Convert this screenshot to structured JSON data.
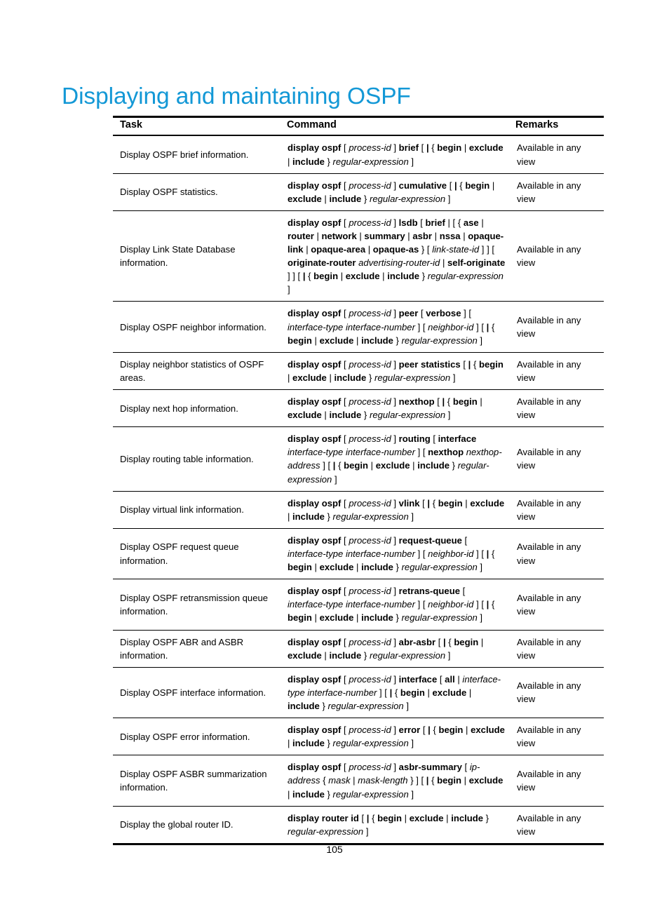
{
  "document": {
    "title": "Displaying and maintaining OSPF",
    "title_color": "#1398d6",
    "page_number": "105"
  },
  "table": {
    "headers": {
      "task": "Task",
      "command": "Command",
      "remarks": "Remarks"
    },
    "rows": [
      {
        "task": "Display OSPF brief information.",
        "command_html": "<b>display ospf</b> [ <i>process-id</i> ] <b>brief</b> [ <b>|</b> { <b>begin</b> | <b>exclude</b> | <b>include</b> } <i>regular-expression</i> ]",
        "command_text": "display ospf [ process-id ] brief [ | { begin | exclude | include } regular-expression ]",
        "remarks": "Available in any view"
      },
      {
        "task": "Display OSPF statistics.",
        "command_html": "<b>display ospf</b> [ <i>process-id</i> ] <b>cumulative</b> [ <b>|</b> { <b>begin</b> | <b>exclude</b> | <b>include</b> } <i>regular-expression</i> ]",
        "command_text": "display ospf [ process-id ] cumulative [ | { begin | exclude | include } regular-expression ]",
        "remarks": "Available in any view"
      },
      {
        "task": "Display Link State Database information.",
        "command_html": "<b>display ospf</b> [ <i>process-id</i> ] <b>lsdb</b> [ <b>brief</b> | [ { <b>ase</b> | <b>router</b> | <b>network</b> | <b>summary</b> | <b>asbr</b> | <b>nssa</b> | <b>opaque-link</b> | <b>opaque-area</b> | <b>opaque-as</b> } [ <i>link-state-id</i> ] ] [ <b>originate-router</b> <i>advertising-router-id</i> | <b>self-originate</b> ] ] [ <b>|</b> { <b>begin</b> | <b>exclude</b> | <b>include</b> } <i>regular-expression</i> ]",
        "command_text": "display ospf [ process-id ] lsdb [ brief | [ { ase | router | network | summary | asbr | nssa | opaque-link | opaque-area | opaque-as } [ link-state-id ] ] [ originate-router advertising-router-id | self-originate ] ] [ | { begin | exclude | include } regular-expression ]",
        "remarks": "Available in any view"
      },
      {
        "task": "Display OSPF neighbor information.",
        "command_html": "<b>display ospf</b> [ <i>process-id</i> ] <b>peer</b> [ <b>verbose</b> ] [ <i>interface-type interface-number</i> ] [ <i>neighbor-id</i> ] [ <b>|</b> { <b>begin</b> | <b>exclude</b> | <b>include</b> } <i>regular-expression</i> ]",
        "command_text": "display ospf [ process-id ] peer [ verbose ] [ interface-type interface-number ] [ neighbor-id ] [ | { begin | exclude | include } regular-expression ]",
        "remarks": "Available in any view"
      },
      {
        "task": "Display neighbor statistics of OSPF areas.",
        "command_html": "<b>display ospf</b> [ <i>process-id</i> ] <b>peer statistics</b> [ <b>|</b> { <b>begin</b> | <b>exclude</b> | <b>include</b> } <i>regular-expression</i> ]",
        "command_text": "display ospf [ process-id ] peer statistics [ | { begin | exclude | include } regular-expression ]",
        "remarks": "Available in any view"
      },
      {
        "task": "Display next hop information.",
        "command_html": "<b>display ospf</b> [ <i>process-id</i> ] <b>nexthop</b> [ <b>|</b> { <b>begin</b> | <b>exclude</b> | <b>include</b> } <i>regular-expression</i> ]",
        "command_text": "display ospf [ process-id ] nexthop [ | { begin | exclude | include } regular-expression ]",
        "remarks": "Available in any view"
      },
      {
        "task": "Display routing table information.",
        "command_html": "<b>display ospf</b> [ <i>process-id</i> ] <b>routing</b> [ <b>interface</b> <i>interface-type interface-number</i> ] [ <b>nexthop</b> <i>nexthop-address</i> ] [ <b>|</b> { <b>begin</b> | <b>exclude</b> | <b>include</b> } <i>regular-expression</i> ]",
        "command_text": "display ospf [ process-id ] routing [ interface interface-type interface-number ] [ nexthop nexthop-address ] [ | { begin | exclude | include } regular-expression ]",
        "remarks": "Available in any view"
      },
      {
        "task": "Display virtual link information.",
        "command_html": "<b>display ospf</b> [ <i>process-id</i> ] <b>vlink</b> [ <b>|</b> { <b>begin</b> | <b>exclude</b> | <b>include</b> } <i>regular-expression</i> ]",
        "command_text": "display ospf [ process-id ] vlink [ | { begin | exclude | include } regular-expression ]",
        "remarks": "Available in any view"
      },
      {
        "task": "Display OSPF request queue information.",
        "command_html": "<b>display ospf</b> [ <i>process-id</i> ] <b>request-queue</b> [ <i>interface-type interface-number</i> ] [ <i>neighbor-id</i> ] [ <b>|</b> { <b>begin</b> | <b>exclude</b> | <b>include</b> } <i>regular-expression</i> ]",
        "command_text": "display ospf [ process-id ] request-queue [ interface-type interface-number ] [ neighbor-id ] [ | { begin | exclude | include } regular-expression ]",
        "remarks": "Available in any view"
      },
      {
        "task": "Display OSPF retransmission queue information.",
        "command_html": "<b>display ospf</b> [ <i>process-id</i> ] <b>retrans-queue</b> [ <i>interface-type interface-number</i> ] [ <i>neighbor-id</i> ] [ <b>|</b> { <b>begin</b> | <b>exclude</b> | <b>include</b> } <i>regular-expression</i> ]",
        "command_text": "display ospf [ process-id ] retrans-queue [ interface-type interface-number ] [ neighbor-id ] [ | { begin | exclude | include } regular-expression ]",
        "remarks": "Available in any view"
      },
      {
        "task": "Display OSPF ABR and ASBR information.",
        "command_html": "<b>display ospf</b> [ <i>process-id</i> ] <b>abr-asbr</b> [ <b>|</b> { <b>begin</b> | <b>exclude</b> | <b>include</b> } <i>regular-expression</i> ]",
        "command_text": "display ospf [ process-id ] abr-asbr [ | { begin | exclude | include } regular-expression ]",
        "remarks": "Available in any view"
      },
      {
        "task": "Display OSPF interface information.",
        "command_html": "<b>display ospf</b> [ <i>process-id</i> ] <b>interface</b> [ <b>all</b> | <i>interface-type interface-number</i> ] [ <b>|</b> { <b>begin</b> | <b>exclude</b> | <b>include</b> } <i>regular-expression</i> ]",
        "command_text": "display ospf [ process-id ] interface [ all | interface-type interface-number ] [ | { begin | exclude | include } regular-expression ]",
        "remarks": "Available in any view"
      },
      {
        "task": "Display OSPF error information.",
        "command_html": "<b>display ospf</b> [ <i>process-id</i> ] <b>error</b> [ <b>|</b> { <b>begin</b> | <b>exclude</b> | <b>include</b> } <i>regular-expression</i> ]",
        "command_text": "display ospf [ process-id ] error [ | { begin | exclude | include } regular-expression ]",
        "remarks": "Available in any view"
      },
      {
        "task": "Display OSPF ASBR summarization information.",
        "command_html": "<b>display ospf</b> [ <i>process-id</i> ] <b>asbr-summary</b> [ <i>ip-address</i> { <i>mask</i> | <i>mask-length</i> } ] [ <b>|</b> { <b>begin</b> | <b>exclude</b> | <b>include</b> } <i>regular-expression</i> ]",
        "command_text": "display ospf [ process-id ] asbr-summary [ ip-address { mask | mask-length } ] [ | { begin | exclude | include } regular-expression ]",
        "remarks": "Available in any view"
      },
      {
        "task": "Display the global router ID.",
        "command_html": "<b>display router id</b> [ <b>|</b> { <b>begin</b> | <b>exclude</b> | <b>include</b> } <i>regular-expression</i> ]",
        "command_text": "display router id [ | { begin | exclude | include } regular-expression ]",
        "remarks": "Available in any view"
      }
    ]
  }
}
